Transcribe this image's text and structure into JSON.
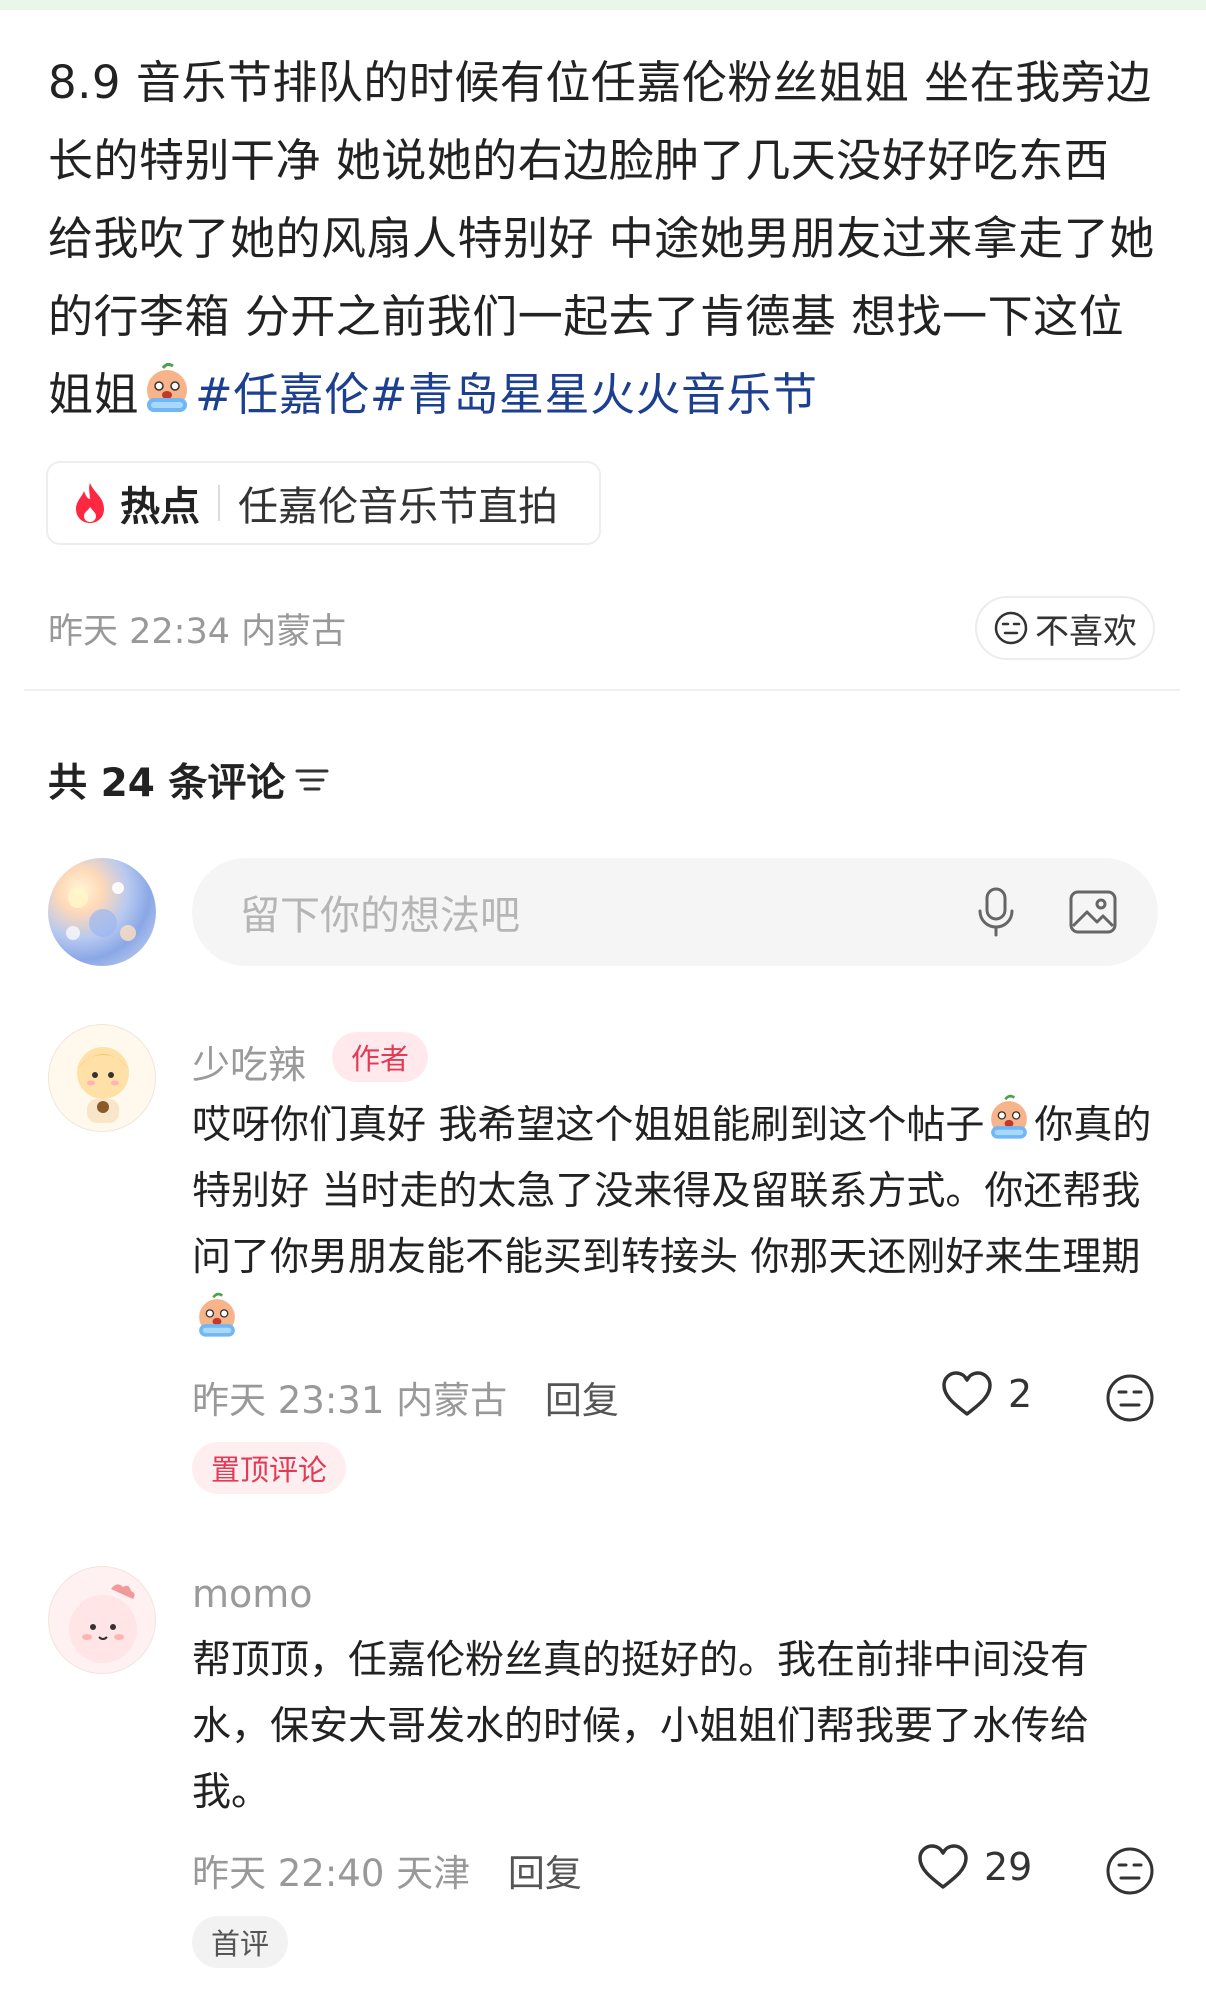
{
  "post": {
    "text": "8.9 音乐节排队的时候有位任嘉伦粉丝姐姐 坐在我旁边 长的特别干净 她说她的右边脸肿了几天没好好吃东西 给我吹了她的风扇人特别好 中途她男朋友过来拿走了她的行李箱 分开之前我们一起去了肯德基 想找一下这位姐姐",
    "tags": [
      "#任嘉伦",
      "#青岛星星火火音乐节"
    ],
    "hot_label": "热点",
    "hot_topic": "任嘉伦音乐节直拍",
    "time": "昨天 22:34",
    "location": "内蒙古",
    "dislike_label": "不喜欢"
  },
  "comments_header": {
    "label": "共 24 条评论"
  },
  "composer": {
    "placeholder": "留下你的想法吧"
  },
  "comments": [
    {
      "user": "少吃辣",
      "badge": "作者",
      "text_parts": [
        "哎呀你们真好 我希望这个姐姐能刷到这个帖子",
        "你真的特别好 当时走的太急了没来得及留联系方式。你还帮我问了你男朋友能不能买到转接头 你那天还刚好来生理期"
      ],
      "time": "昨天 23:31",
      "location": "内蒙古",
      "reply": "回复",
      "likes": "2",
      "tag": "置顶评论"
    },
    {
      "user": "momo",
      "text": "帮顶顶，任嘉伦粉丝真的挺好的。我在前排中间没有水，保安大哥发水的时候，小姐姐们帮我要了水传给我。",
      "time": "昨天 22:40",
      "location": "天津",
      "reply": "回复",
      "likes": "29",
      "tag": "首评"
    }
  ],
  "colors": {
    "hashtag": "#1d3f8f",
    "badge_red": "#e23b56",
    "meta_gray": "#999999"
  },
  "icons": [
    "fire-icon",
    "crying-face-emoji",
    "neutral-face-icon",
    "filter-icon",
    "mic-icon",
    "image-icon",
    "heart-icon"
  ]
}
